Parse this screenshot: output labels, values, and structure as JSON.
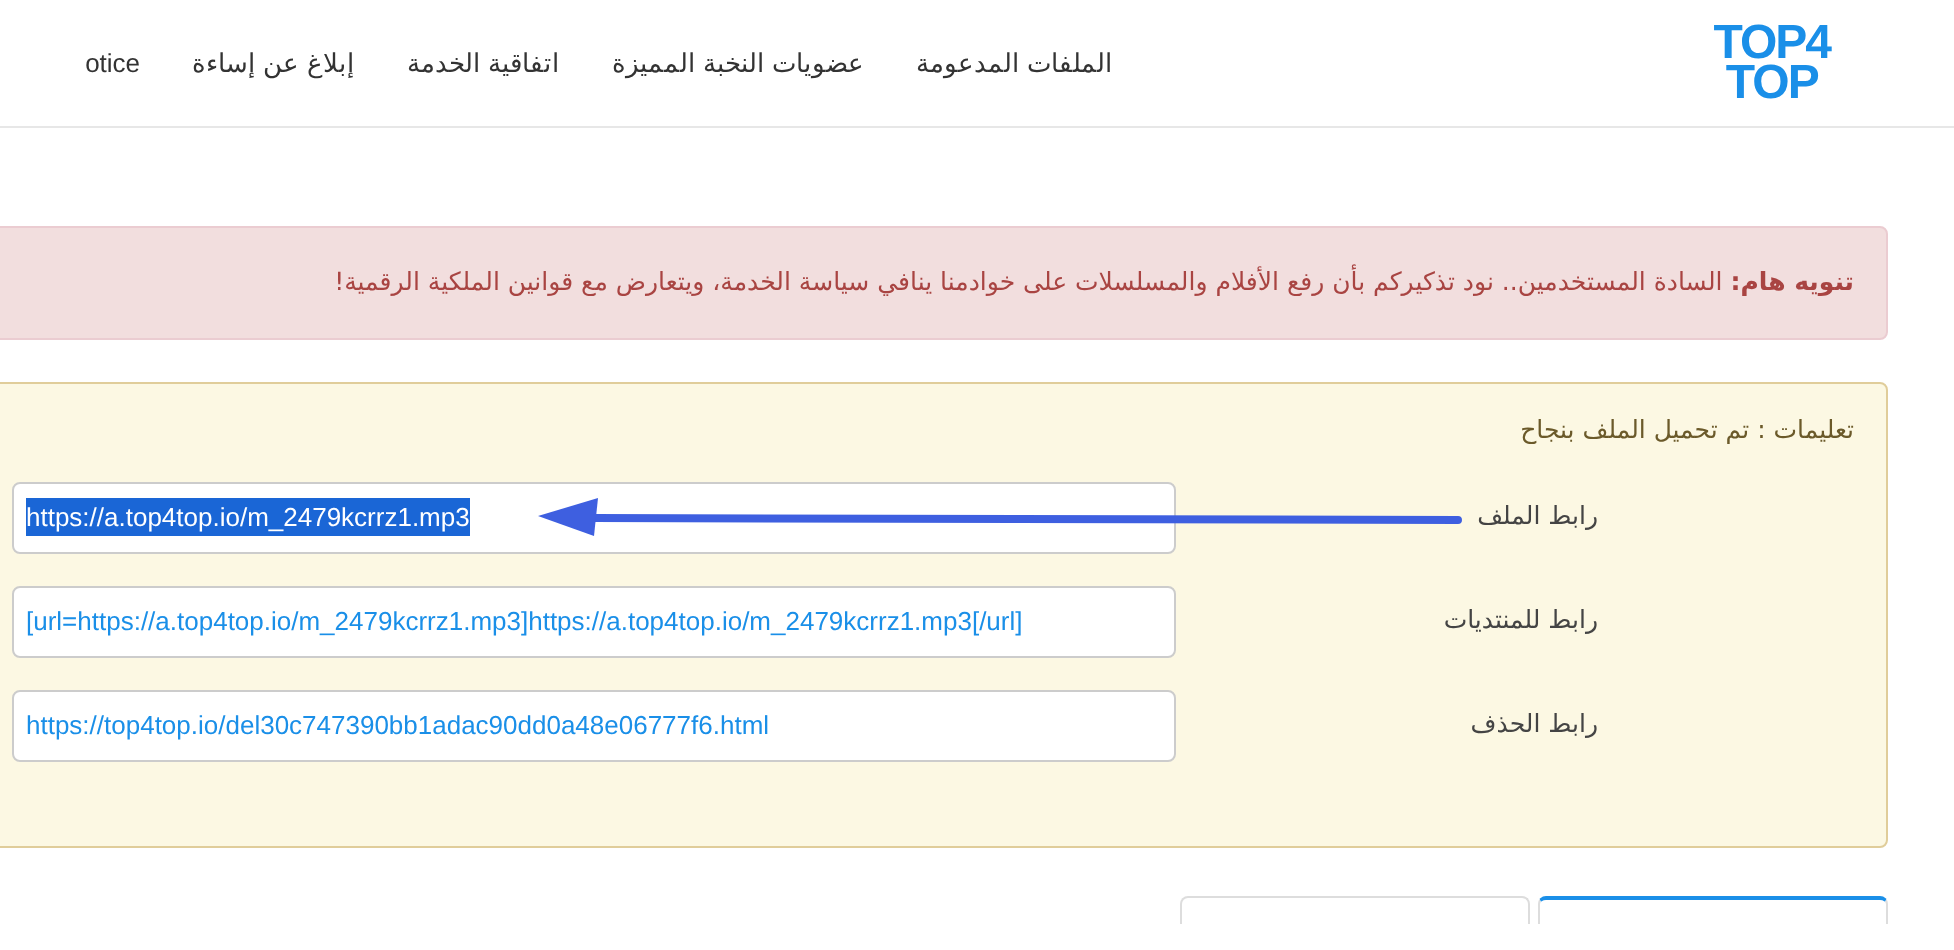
{
  "logo": {
    "line_1": "TOP4",
    "line_2": "TOP"
  },
  "nav": [
    "الملفات المدعومة",
    "عضويات النخبة المميزة",
    "اتفاقية الخدمة",
    "إبلاغ عن إساءة",
    "otice"
  ],
  "alert": {
    "title": "تنويه هام:",
    "text": "السادة المستخدمين.. نود تذكيركم بأن رفع الأفلام والمسلسلات على خوادمنا ينافي سياسة الخدمة، ويتعارض مع قوانين الملكية الرقمية!"
  },
  "panel": {
    "heading": "تعليمات : تم تحميل الملف بنجاح",
    "fields": [
      {
        "label": "رابط الملف",
        "value": "https://a.top4top.io/m_2479kcrrz1.mp3",
        "highlighted": true,
        "arrow": true
      },
      {
        "label": "رابط للمنتديات",
        "value": "[url=https://a.top4top.io/m_2479kcrrz1.mp3]https://a.top4top.io/m_2479kcrrz1.mp3[/url]",
        "highlighted": false,
        "arrow": false
      },
      {
        "label": "رابط الحذف",
        "value": "https://top4top.io/del30c747390bb1adac90dd0a48e06777f6.html",
        "highlighted": false,
        "arrow": false
      }
    ]
  },
  "tabs": [
    {
      "selected": true
    },
    {
      "selected": false
    }
  ]
}
